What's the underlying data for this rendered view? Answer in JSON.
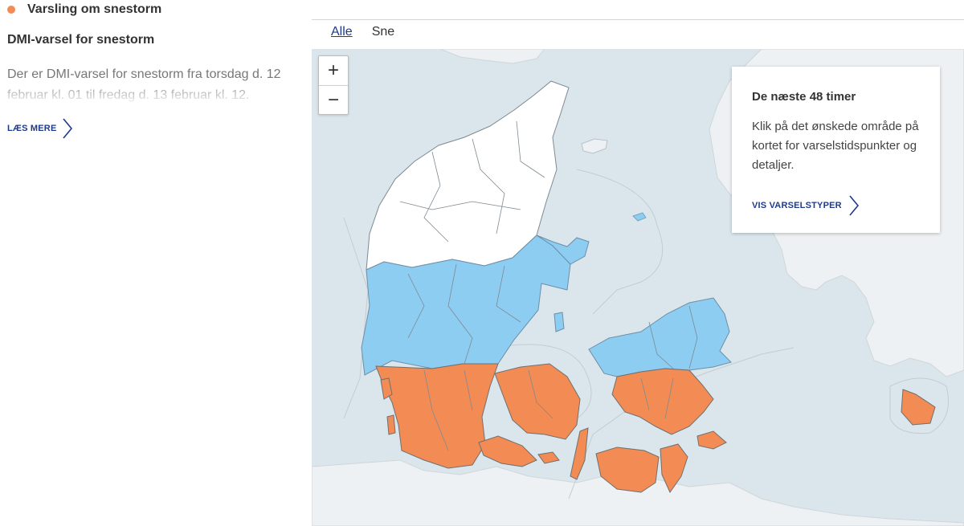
{
  "alert": {
    "title": "Varsling om snestorm",
    "dot_color": "#f28c54"
  },
  "warning": {
    "title": "DMI-varsel for snestorm",
    "text": "Der er DMI-varsel for snestorm fra torsdag d. 12 februar kl. 01 til fredag d. 13 februar kl. 12.",
    "read_more": "LÆS MERE"
  },
  "tabs": [
    {
      "label": "Alle",
      "active": true
    },
    {
      "label": "Sne",
      "active": false
    }
  ],
  "map": {
    "zoom_in": "+",
    "zoom_out": "−",
    "colors": {
      "sea": "#dbe6ec",
      "foreign_land": "#eef1f3",
      "no_warning": "#ffffff",
      "moderate": "#8ecdf2",
      "severe": "#f28c54"
    },
    "info": {
      "title": "De næste 48 timer",
      "text": "Klik på det ønskede område på kortet for varselstidspunkter og detaljer.",
      "link": "VIS VARSELSTYPER"
    }
  }
}
